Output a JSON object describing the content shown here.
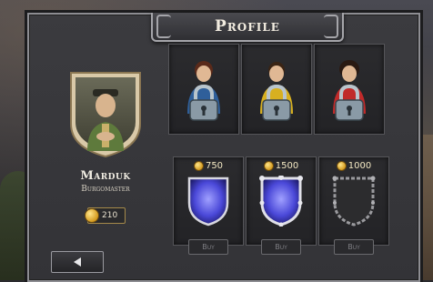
{
  "header": {
    "title": "Profile"
  },
  "profile": {
    "name": "Marduk",
    "rank": "Burgomaster",
    "coins": "210"
  },
  "characters": [
    {
      "label": "Locked character 1",
      "locked": true,
      "accent": "#2f5f9a"
    },
    {
      "label": "Locked character 2",
      "locked": true,
      "accent": "#d8b020"
    },
    {
      "label": "Locked character 3",
      "locked": true,
      "accent": "#c02a2a"
    }
  ],
  "shields": [
    {
      "price": "750",
      "buy_label": "Buy",
      "style": "blue-plain"
    },
    {
      "price": "1500",
      "buy_label": "Buy",
      "style": "blue-spiked"
    },
    {
      "price": "1000",
      "buy_label": "Buy",
      "style": "dark-spiked"
    }
  ],
  "colors": {
    "gold": "#d39a1e",
    "shield_blue": "#4a48d8",
    "panel": "#343438"
  }
}
